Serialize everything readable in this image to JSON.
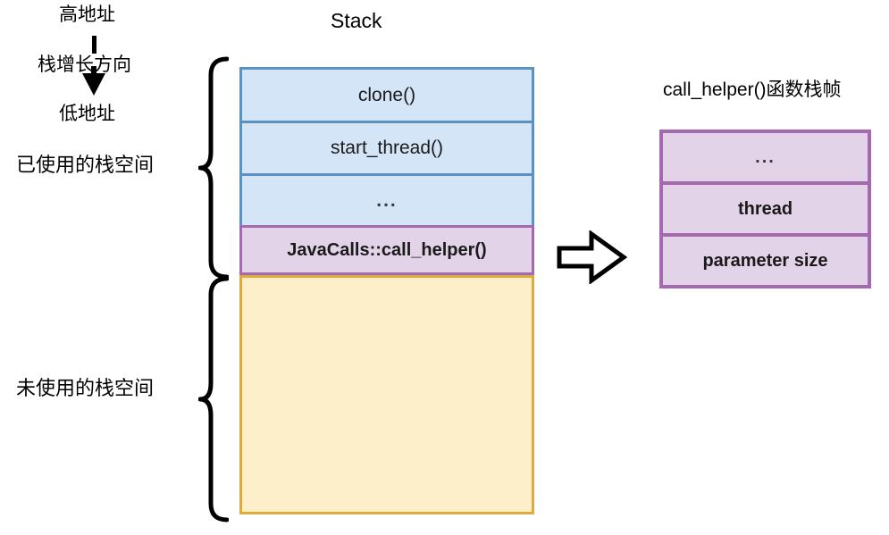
{
  "diagram": {
    "address_direction": {
      "high_label": "高地址",
      "direction_label": "栈增长方向",
      "low_label": "低地址",
      "arrow_icon": "down-arrow-icon"
    },
    "region_labels": {
      "used": "已使用的栈空间",
      "unused": "未使用的栈空间"
    },
    "stack": {
      "title": "Stack",
      "frames": [
        {
          "label": "clone()",
          "kind": "blue"
        },
        {
          "label": "start_thread()",
          "kind": "blue"
        },
        {
          "label": "...",
          "kind": "blue"
        },
        {
          "label": "JavaCalls::call_helper()",
          "kind": "purple"
        }
      ],
      "unused_region": {
        "label": "",
        "kind": "unused"
      }
    },
    "transition": {
      "arrow_icon": "block-right-arrow-icon"
    },
    "detail_panel": {
      "title": "call_helper()函数栈帧",
      "rows": [
        {
          "label": "..."
        },
        {
          "label": "thread"
        },
        {
          "label": "parameter size"
        }
      ]
    },
    "colors": {
      "blue_fill": "#d4e5f7",
      "blue_border": "#5b92c4",
      "purple_fill": "#e3d3e8",
      "purple_border": "#a569b0",
      "yellow_fill": "#fcefca",
      "yellow_border": "#e0ab3c",
      "outline": "#000000",
      "background": "#ffffff"
    }
  }
}
